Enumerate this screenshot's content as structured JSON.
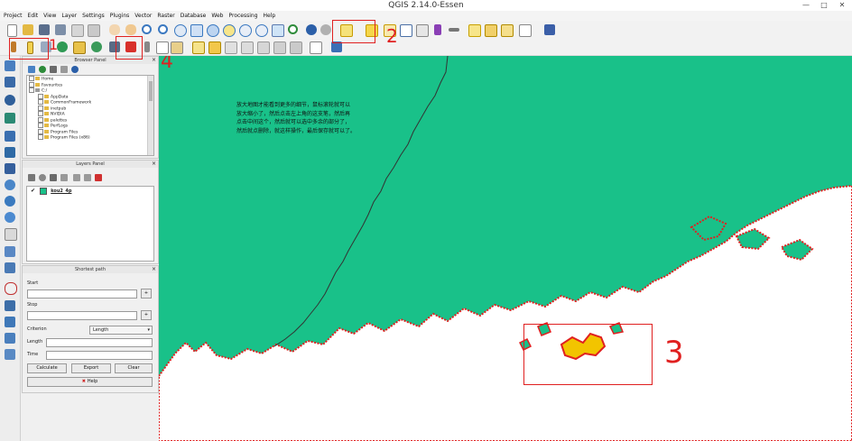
{
  "window": {
    "title": "QGIS 2.14.0-Essen",
    "minimize": "—",
    "maximize": "□",
    "close": "✕"
  },
  "menubar": [
    "Project",
    "Edit",
    "View",
    "Layer",
    "Settings",
    "Plugins",
    "Vector",
    "Raster",
    "Database",
    "Web",
    "Processing",
    "Help"
  ],
  "browser_panel": {
    "title": "Browser Panel",
    "close": "×",
    "items": [
      "Home",
      "Favourites",
      "C:/",
      "AppData",
      "CommonFramework",
      "inetpub",
      "NVIDIA",
      "palettes",
      "PerfLogs",
      "Program Files",
      "Program Files (x86)"
    ]
  },
  "layers_panel": {
    "title": "Layers Panel",
    "close": "×",
    "layer": {
      "name": "kou2_4p",
      "checked": "✔"
    }
  },
  "shortest_path": {
    "title": "Shortest path",
    "close": "×",
    "start_label": "Start",
    "stop_label": "Stop",
    "criterion_label": "Criterion",
    "criterion_value": "Length",
    "length_label": "Length",
    "time_label": "Time",
    "calculate": "Calculate",
    "export": "Export",
    "clear": "Clear",
    "help": "Help",
    "plus": "+"
  },
  "annotations": {
    "note_lines": [
      "放大地图才能看到更多的细节，鼠标滚轮就可以",
      "放大缩小了，然后点击左上角的这支笔，然后再",
      "点击中间这个，然后就可以选中多余的部分了，",
      "然后就点删除，就这样操作，最后保存就可以了。"
    ],
    "num_1": "1",
    "num_2": "2",
    "num_3": "3",
    "num_4": "4"
  },
  "colors": {
    "map_fill": "#19c189",
    "coast": "#e02020",
    "highlight": "#f2c400",
    "annotation": "#e02020"
  }
}
